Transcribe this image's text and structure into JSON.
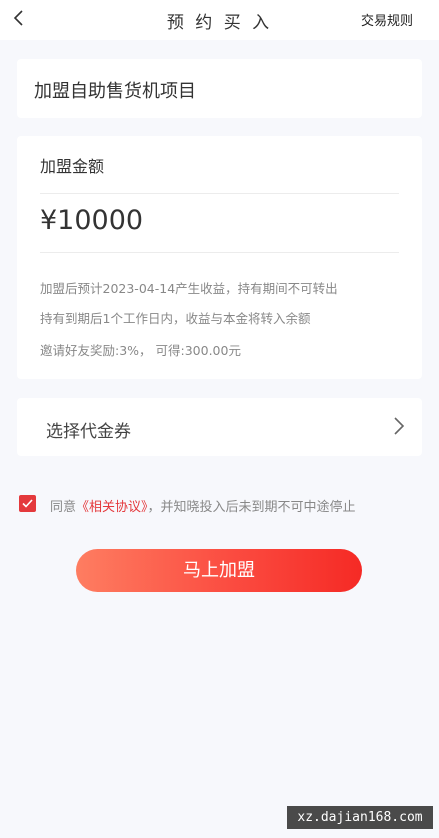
{
  "header": {
    "title": "预 约 买 入",
    "rules_label": "交易规则"
  },
  "project": {
    "name": "加盟自助售货机项目"
  },
  "amount": {
    "label": "加盟金额",
    "value": "¥10000",
    "notes": [
      "加盟后预计2023-04-14产生收益，持有期间不可转出",
      "持有到期后1个工作日内，收益与本金将转入余额",
      "邀请好友奖励:3%， 可得:300.00元"
    ]
  },
  "coupon": {
    "label": "选择代金券"
  },
  "agreement": {
    "checked": true,
    "prefix": "同意",
    "link": "《相关协议》",
    "suffix": "，并知晓投入后未到期不可中途停止"
  },
  "actions": {
    "join_label": "马上加盟"
  },
  "watermark": {
    "text": "xz.dajian168.com"
  },
  "colors": {
    "accent": "#e4393c",
    "button_gradient_start": "#fe7d61",
    "button_gradient_end": "#f52a25",
    "page_background": "#f7f8fc"
  }
}
